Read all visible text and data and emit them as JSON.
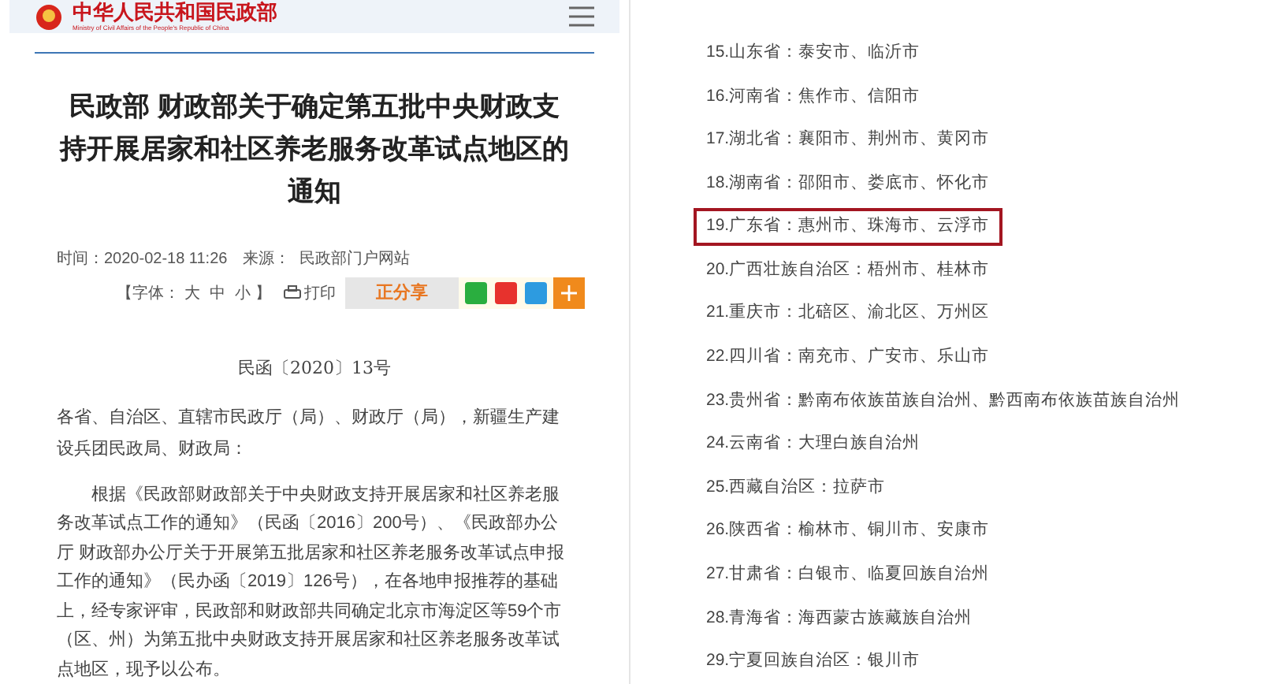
{
  "left": {
    "header": {
      "logo_title": "中华人民共和国民政部",
      "logo_subtitle": "Ministry of Civil Affairs of the People's Republic of China"
    },
    "article": {
      "title": "民政部 财政部关于确定第五批中央财政支持开展居家和社区养老服务改革试点地区的通知",
      "meta": "时间：2020-02-18 11:26　来源：  民政部门户网站",
      "font_label": "【字体：",
      "font_sizes": [
        "大",
        "中",
        "小"
      ],
      "font_end": "】",
      "print": "打印",
      "share": "正分享",
      "doc_number": "民函〔2020〕13号",
      "salutation": "各省、自治区、直辖市民政厅（局）、财政厅（局），新疆生产建设兵团民政局、财政局：",
      "paragraph": "根据《民政部财政部关于中央财政支持开展居家和社区养老服务改革试点工作的通知》（民函〔2016〕200号）、《民政部办公厅 财政部办公厅关于开展第五批居家和社区养老服务改革试点申报工作的通知》（民办函〔2019〕126号），在各地申报推荐的基础上，经专家评审，民政部和财政部共同确定北京市海淀区等59个市（区、州）为第五批中央财政支持开展居家和社区养老服务改革试点地区，现予以公布。"
    }
  },
  "right": {
    "items": [
      {
        "text": "15.山东省：泰安市、临沂市",
        "highlighted": false
      },
      {
        "text": "16.河南省：焦作市、信阳市",
        "highlighted": false
      },
      {
        "text": "17.湖北省：襄阳市、荆州市、黄冈市",
        "highlighted": false
      },
      {
        "text": "18.湖南省：邵阳市、娄底市、怀化市",
        "highlighted": false
      },
      {
        "text": "19.广东省：惠州市、珠海市、云浮市",
        "highlighted": true
      },
      {
        "text": "20.广西壮族自治区：梧州市、桂林市",
        "highlighted": false
      },
      {
        "text": "21.重庆市：北碚区、渝北区、万州区",
        "highlighted": false
      },
      {
        "text": "22.四川省：南充市、广安市、乐山市",
        "highlighted": false
      },
      {
        "text": "23.贵州省：黔南布依族苗族自治州、黔西南布依族苗族自治州",
        "highlighted": false
      },
      {
        "text": "24.云南省：大理白族自治州",
        "highlighted": false
      },
      {
        "text": "25.西藏自治区：拉萨市",
        "highlighted": false
      },
      {
        "text": "26.陕西省：榆林市、铜川市、安康市",
        "highlighted": false
      },
      {
        "text": "27.甘肃省：白银市、临夏回族自治州",
        "highlighted": false
      },
      {
        "text": "28.青海省：海西蒙古族藏族自治州",
        "highlighted": false
      },
      {
        "text": "29.宁夏回族自治区：银川市",
        "highlighted": false
      }
    ]
  }
}
